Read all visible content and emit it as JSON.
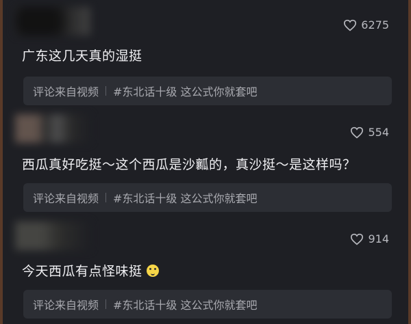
{
  "comments": [
    {
      "likes": "6275",
      "text": "广东这几天真的湿挺",
      "source_label": "评论来自视频",
      "source_tag": "#东北话十级 这公式你就套吧"
    },
    {
      "likes": "554",
      "text": "西瓜真好吃挺～这个西瓜是沙瓤的，真沙挺～是这样吗？",
      "source_label": "评论来自视频",
      "source_tag": "#东北话十级 这公式你就套吧"
    },
    {
      "likes": "914",
      "text": "今天西瓜有点怪味挺",
      "emoji": "scared-face",
      "source_label": "评论来自视频",
      "source_tag": "#东北话十级 这公式你就套吧"
    }
  ],
  "colors": {
    "background": "#1e1f24",
    "source_bg": "#2c2e34",
    "text": "#f1f1f4",
    "muted": "#a9aab0"
  }
}
